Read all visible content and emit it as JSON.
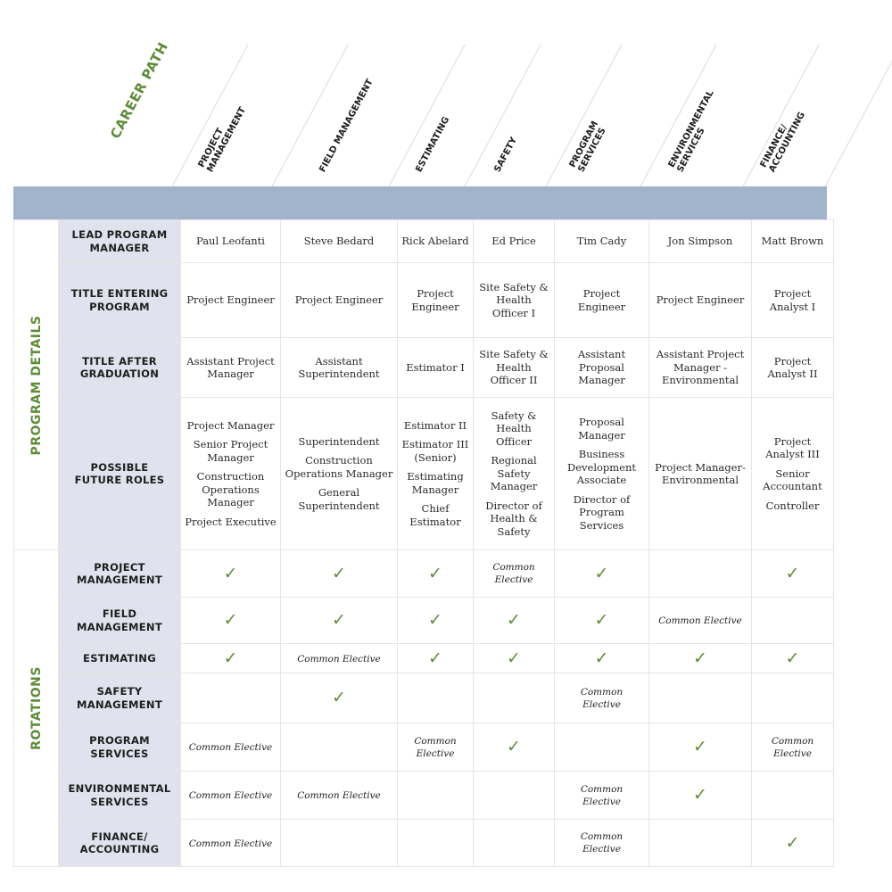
{
  "title": "CAREER PATH",
  "columns": [
    {
      "lines": [
        "PROJECT",
        "MANAGEMENT"
      ]
    },
    {
      "lines": [
        "FIELD MANAGEMENT"
      ]
    },
    {
      "lines": [
        "ESTIMATING"
      ]
    },
    {
      "lines": [
        "SAFETY"
      ]
    },
    {
      "lines": [
        "PROGRAM",
        "SERVICES"
      ]
    },
    {
      "lines": [
        "ENVIRONMENTAL",
        "SERVICES"
      ]
    },
    {
      "lines": [
        "FINANCE/",
        "ACCOUNTING"
      ]
    }
  ],
  "colors": {
    "accent_green": "#5e8c3a",
    "band_blue": "#a0b4cc",
    "rowhead_bg": "#e0e3ed"
  },
  "sections": [
    {
      "label": "PROGRAM DETAILS",
      "rows": [
        {
          "label": [
            "LEAD PROGRAM",
            "MANAGER"
          ],
          "cells": [
            [
              "Paul Leofanti"
            ],
            [
              "Steve Bedard"
            ],
            [
              "Rick Abelard"
            ],
            [
              "Ed Price"
            ],
            [
              "Tim Cady"
            ],
            [
              "Jon Simpson"
            ],
            [
              "Matt Brown"
            ]
          ]
        },
        {
          "label": [
            "TITLE ENTERING",
            "PROGRAM"
          ],
          "cells": [
            [
              "Project Engineer"
            ],
            [
              "Project Engineer"
            ],
            [
              "Project Engineer"
            ],
            [
              "Site Safety & Health Officer I"
            ],
            [
              "Project Engineer"
            ],
            [
              "Project Engineer"
            ],
            [
              "Project Analyst I"
            ]
          ]
        },
        {
          "label": [
            "TITLE AFTER",
            "GRADUATION"
          ],
          "cells": [
            [
              "Assistant Project Manager"
            ],
            [
              "Assistant Superintendent"
            ],
            [
              "Estimator I"
            ],
            [
              "Site Safety & Health Officer II"
            ],
            [
              "Assistant Proposal Manager"
            ],
            [
              "Assistant Project Manager - Environmental"
            ],
            [
              "Project Analyst II"
            ]
          ]
        },
        {
          "label": [
            "POSSIBLE",
            "FUTURE ROLES"
          ],
          "cells": [
            [
              "Project Manager",
              "Senior Project Manager",
              "Construction Operations Manager",
              "Project Executive"
            ],
            [
              "Superintendent",
              "Construction Operations Manager",
              "General Superintendent"
            ],
            [
              "Estimator II",
              "Estimator III (Senior)",
              "Estimating Manager",
              "Chief Estimator"
            ],
            [
              "Safety & Health Officer",
              "Regional Safety Manager",
              "Director of Health & Safety"
            ],
            [
              "Proposal Manager",
              "Business Development Associate",
              "Director of Program Services"
            ],
            [
              "Project Manager-Environmental"
            ],
            [
              "Project Analyst III",
              "Senior Accountant",
              "Controller"
            ]
          ]
        }
      ]
    },
    {
      "label": "ROTATIONS",
      "check_icon": "checkmark-icon",
      "check_glyph": "✓",
      "elective_text": "Common Elective",
      "rows": [
        {
          "label": [
            "PROJECT",
            "MANAGEMENT"
          ],
          "cells": [
            "check",
            "check",
            "check",
            "elective",
            "check",
            "",
            "check"
          ]
        },
        {
          "label": [
            "FIELD",
            "MANAGEMENT"
          ],
          "cells": [
            "check",
            "check",
            "check",
            "check",
            "check",
            "elective",
            ""
          ]
        },
        {
          "label": [
            "ESTIMATING"
          ],
          "cells": [
            "check",
            "elective",
            "check",
            "check",
            "check",
            "check",
            "check"
          ]
        },
        {
          "label": [
            "SAFETY",
            "MANAGEMENT"
          ],
          "cells": [
            "",
            "check",
            "",
            "",
            "elective",
            "",
            ""
          ]
        },
        {
          "label": [
            "PROGRAM",
            "SERVICES"
          ],
          "cells": [
            "elective",
            "",
            "elective",
            "check",
            "",
            "check",
            "elective"
          ]
        },
        {
          "label": [
            "ENVIRONMENTAL",
            "SERVICES"
          ],
          "cells": [
            "elective",
            "elective",
            "",
            "",
            "elective",
            "check",
            ""
          ]
        },
        {
          "label": [
            "FINANCE/",
            "ACCOUNTING"
          ],
          "cells": [
            "elective",
            "",
            "",
            "",
            "elective",
            "",
            "check"
          ]
        }
      ]
    }
  ]
}
